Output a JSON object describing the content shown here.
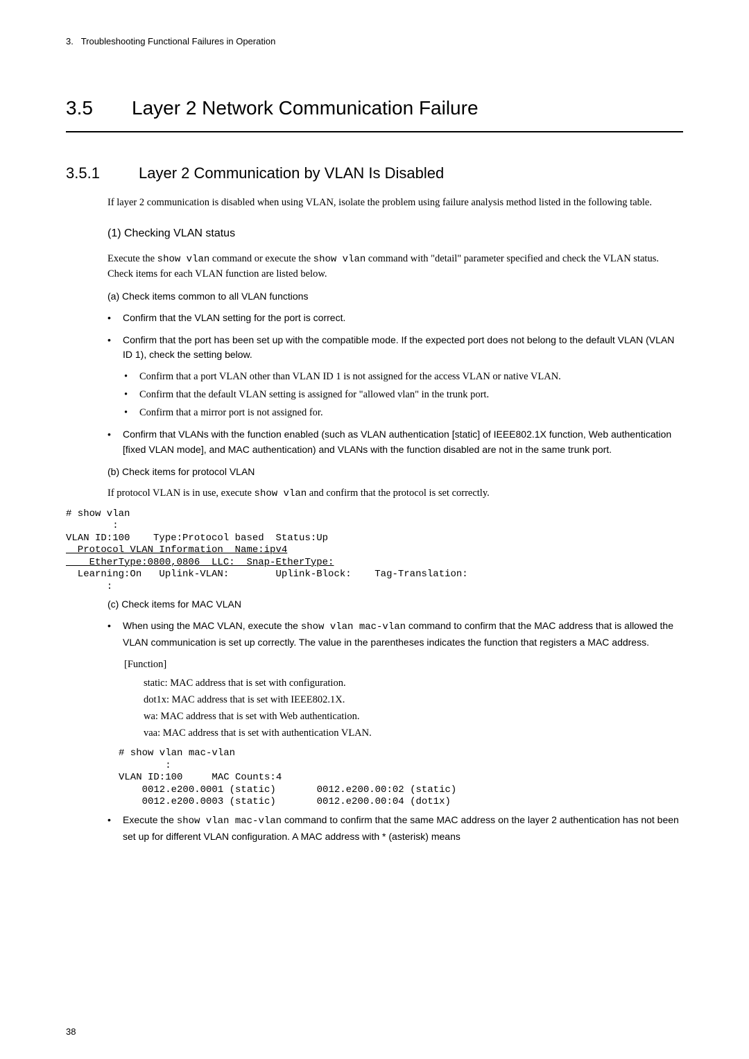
{
  "header": {
    "chapter_num": "3.",
    "chapter_title": "Troubleshooting Functional Failures in Operation"
  },
  "h1": {
    "num": "3.5",
    "title": "Layer 2 Network Communication Failure"
  },
  "h2": {
    "num": "3.5.1",
    "title": "Layer 2 Communication by VLAN Is Disabled"
  },
  "intro": "If layer 2 communication is disabled when using VLAN, isolate the problem using failure analysis method listed in the following table.",
  "s1": {
    "title": "(1)  Checking VLAN status",
    "p1_a": "Execute the ",
    "p1_cmd1": "show vlan",
    "p1_b": " command or execute the ",
    "p1_cmd2": "show vlan",
    "p1_c": " command with \"detail\" parameter specified and check the VLAN status. Check items for each VLAN function are listed below.",
    "a": {
      "title": "(a)   Check items common to all VLAN functions",
      "b1": "Confirm that the VLAN setting for the port is correct.",
      "b2": "Confirm that the port has been set up with the compatible mode. If the expected port does not belong to the default VLAN (VLAN ID 1), check the setting below.",
      "b2s1": "Confirm that a port VLAN other than VLAN ID 1 is not assigned for the access VLAN or native VLAN.",
      "b2s2": "Confirm that the default VLAN setting is assigned for \"allowed vlan\" in the trunk port.",
      "b2s3": "Confirm that a mirror port is not assigned for.",
      "b3": "Confirm that VLANs with the function enabled (such as VLAN authentication [static] of IEEE802.1X function, Web authentication [fixed VLAN mode], and MAC authentication) and VLANs with the function disabled are not in the same trunk port."
    },
    "b": {
      "title": "(b)   Check items for protocol VLAN",
      "p1_a": "If protocol VLAN is in use, execute ",
      "p1_cmd": "show vlan",
      "p1_b": " and confirm that the protocol is set correctly.",
      "code_l1": "# show vlan",
      "code_l2": "        :",
      "code_l3": "VLAN ID:100    Type:Protocol based  Status:Up",
      "code_l4": "  Protocol VLAN Information  Name:ipv4",
      "code_l5": "    EtherType:0800,0806  LLC:  Snap-EtherType:",
      "code_l6": "  Learning:On   Uplink-VLAN:        Uplink-Block:    Tag-Translation:",
      "code_l7": "       :"
    },
    "c": {
      "title": "(c)   Check items for MAC VLAN",
      "b1_a": "When using the MAC VLAN, execute the ",
      "b1_cmd": "show vlan mac-vlan",
      "b1_b": " command to confirm that the MAC address that is allowed the VLAN communication is set up correctly. The value in the parentheses indicates the function that registers a MAC address.",
      "func_label": "[Function]",
      "f1": "static: MAC address that is set with configuration.",
      "f2": "dot1x: MAC address that is set with IEEE802.1X.",
      "f3": "wa: MAC address that is set with Web authentication.",
      "f4": "vaa: MAC address that is set with authentication VLAN.",
      "code": "# show vlan mac-vlan\n        :\nVLAN ID:100     MAC Counts:4\n    0012.e200.0001 (static)       0012.e200.00:02 (static)\n    0012.e200.0003 (static)       0012.e200.00:04 (dot1x)",
      "b2_a": "Execute the ",
      "b2_cmd": "show vlan mac-vlan",
      "b2_b": "  command  to confirm that the same MAC address on the layer 2 authentication has not been set up for different VLAN configuration. A MAC address with * (asterisk) means"
    }
  },
  "page_num": "38"
}
